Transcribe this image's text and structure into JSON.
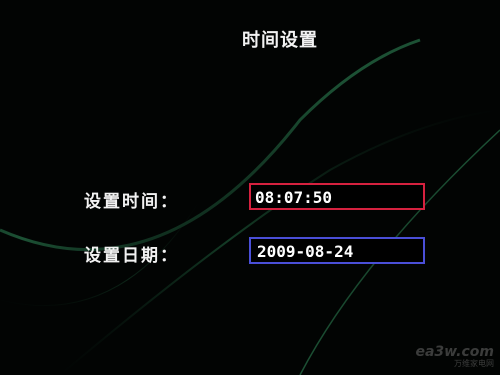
{
  "screen": {
    "title": "时间设置"
  },
  "settings": {
    "time_label": "设置时间：",
    "time_value": "08:07:50",
    "date_label": "设置日期：",
    "date_value": "2009-08-24"
  },
  "watermark": {
    "logo": "ea3w.com",
    "subtitle": "万维家电网"
  },
  "colors": {
    "background": "#020403",
    "accent_green": "#1f5a3a",
    "time_field_border": "#d6213f",
    "date_field_border": "#4a4fd8",
    "text": "#f2f2f2"
  }
}
